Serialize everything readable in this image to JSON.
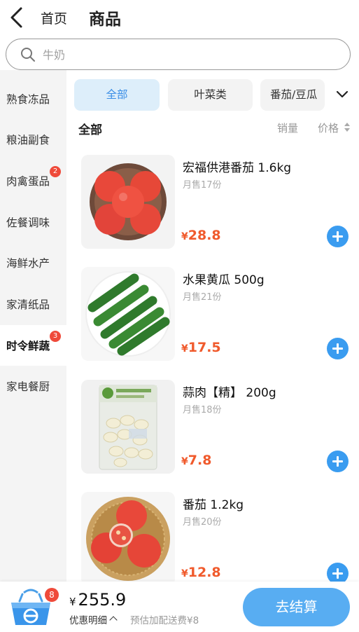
{
  "header": {
    "home_label": "首页",
    "title": "商品"
  },
  "search": {
    "placeholder": "牛奶"
  },
  "sidebar": {
    "items": [
      {
        "label": "熟食冻品",
        "badge": ""
      },
      {
        "label": "粮油副食",
        "badge": ""
      },
      {
        "label": "肉禽蛋品",
        "badge": "2"
      },
      {
        "label": "佐餐调味",
        "badge": ""
      },
      {
        "label": "海鲜水产",
        "badge": ""
      },
      {
        "label": "家清纸品",
        "badge": ""
      },
      {
        "label": "时令鲜蔬",
        "badge": "3",
        "active": true
      },
      {
        "label": "家电餐厨",
        "badge": ""
      }
    ]
  },
  "categories": {
    "chips": [
      {
        "label": "全部",
        "active": true
      },
      {
        "label": "叶菜类"
      },
      {
        "label": "番茄/豆瓜"
      }
    ]
  },
  "section": {
    "title": "全部",
    "sort_sales": "销量",
    "sort_price": "价格"
  },
  "products": [
    {
      "name": "宏福供港番茄 1.6kg",
      "sold": "月售17份",
      "currency": "¥",
      "price": "28.8",
      "image": "tomatoes-on-plate"
    },
    {
      "name": "水果黄瓜 500g",
      "sold": "月售21份",
      "currency": "¥",
      "price": "17.5",
      "image": "cucumbers-on-plate"
    },
    {
      "name": "蒜肉【精】 200g",
      "sold": "月售18份",
      "currency": "¥",
      "price": "7.8",
      "image": "garlic-pack"
    },
    {
      "name": "番茄 1.2kg",
      "sold": "月售20份",
      "currency": "¥",
      "price": "12.8",
      "image": "tomatoes-in-basket"
    }
  ],
  "cart": {
    "badge": "8",
    "currency": "¥",
    "total": "255.9",
    "discount_label": "优惠明细",
    "delivery_note": "预估加配送费¥8",
    "checkout_label": "去结算"
  },
  "colors": {
    "accent": "#3a9cf0",
    "price": "#f05a2c",
    "badge": "#ef4a3a",
    "checkout": "#58adf2"
  },
  "icons": [
    "back-arrow-icon",
    "search-icon",
    "chevron-down-icon",
    "sort-arrows-icon",
    "plus-icon",
    "cart-basket-icon"
  ]
}
